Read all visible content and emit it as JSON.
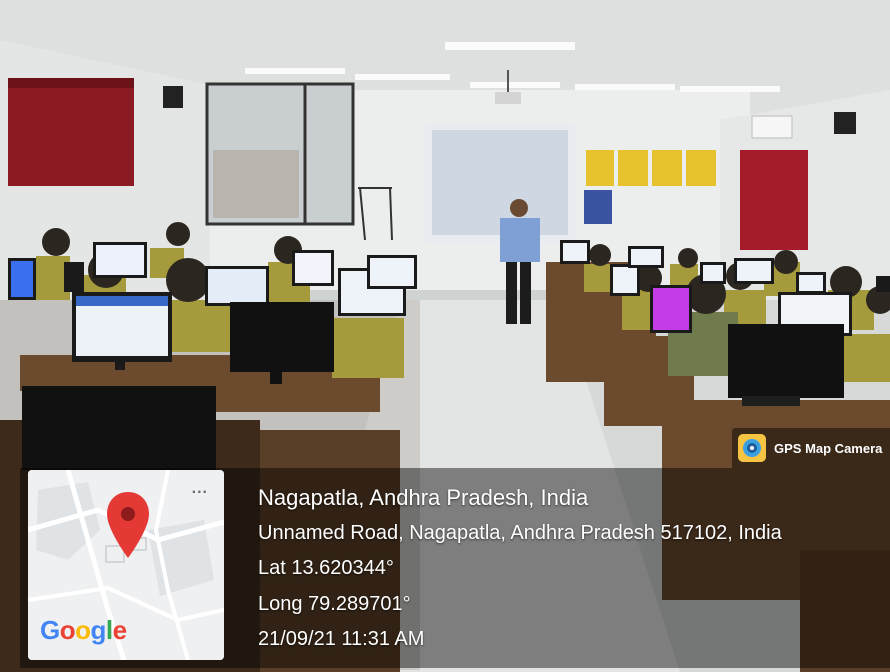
{
  "gps_badge": {
    "app_name": "GPS Map Camera",
    "icon": "gps-map-camera-icon"
  },
  "map": {
    "logo_text": "Google",
    "logo_colors": [
      "#4285F4",
      "#EA4335",
      "#FBBC05",
      "#4285F4",
      "#34A853",
      "#EA4335"
    ],
    "pin_icon": "location-pin-icon",
    "pin_color": "#E53935",
    "more_icon": "more-dots-icon",
    "more_text": "..."
  },
  "location": {
    "place": "Nagapatla, Andhra Pradesh, India",
    "address": "Unnamed Road, Nagapatla, Andhra Pradesh 517102, India",
    "lat": "Lat 13.620344°",
    "long": "Long 79.289701°",
    "datetime": "21/09/21 11:31 AM"
  },
  "colors": {
    "wall": "#e9ecea",
    "ceiling": "#dcdfdd",
    "curtain": "#8b1a22",
    "uniform": "#a59a3c",
    "desk": "#6b4a2e",
    "floor": "#d9dcdb"
  }
}
